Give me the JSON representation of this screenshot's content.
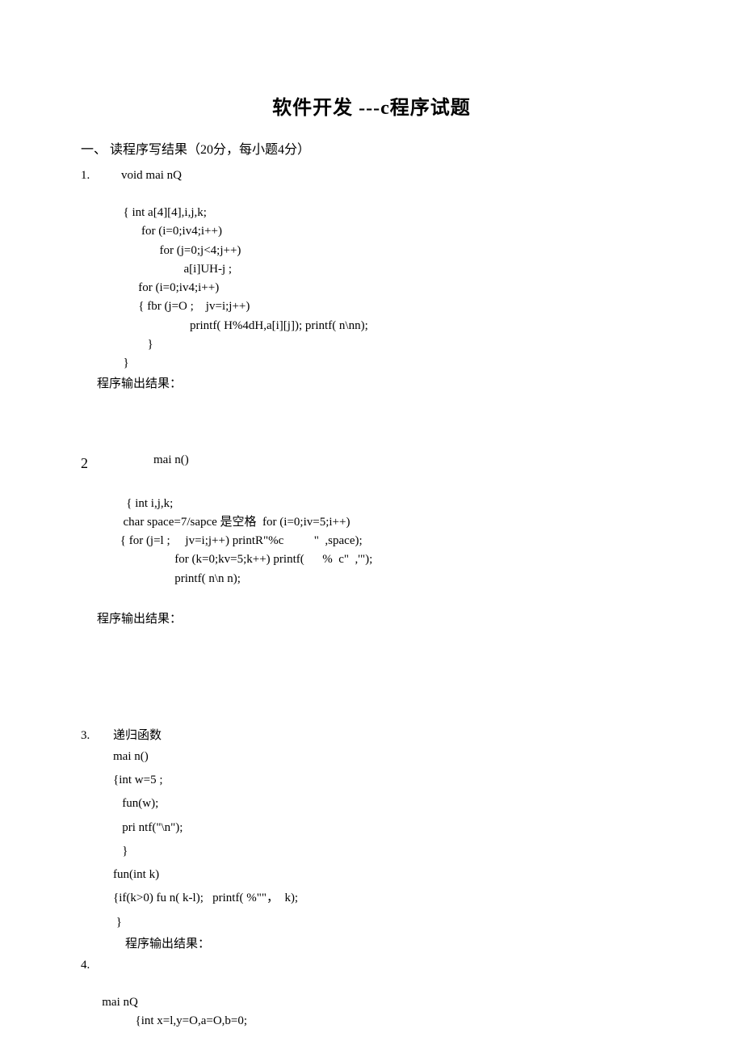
{
  "title": "软件开发 ---c程序试题",
  "section1": {
    "heading": "一、    读程序写结果（20分，每小题4分）",
    "q1": {
      "num": "1.",
      "l1": "void mai nQ",
      "l2": "{ int a[4][4],i,j,k;",
      "l3": "for (i=0;iv4;i++)",
      "l4": "for (j=0;j<4;j++)",
      "l5": "a[i]UH-j ;",
      "l6": "for (i=0;iv4;i++)",
      "l7": "{ fbr (j=O ;    jv=i;j++)",
      "l8": "printf( H%4dH,a[i][j]); printf( n\\nn);",
      "l9": "}",
      "l10": "}",
      "result": "程序输出结果："
    },
    "q2": {
      "num": "2",
      "l1": "mai n()",
      "l2": "{ int i,j,k;",
      "l3": "char space=7/sapce 是空格  for (i=0;iv=5;i++)",
      "l4": "{ for (j=l ;     jv=i;j++) printR\"%c          \"  ,space);",
      "l5": "for (k=0;kv=5;k++) printf(      %  c\"  ,'\");",
      "l6": "printf( n\\n n);",
      "result": "程序输出结果："
    },
    "q3": {
      "num": "3.",
      "label": "递归函数",
      "l1": "mai n()",
      "l2": "{int w=5 ;",
      "l3": "fun(w);",
      "l4": "pri ntf(\"\\n\");",
      "l5": "}",
      "l6": "fun(int k)",
      "l7": "{if(k>0) fu n( k-l);   printf( %\"\"，  k);",
      "l8": "}",
      "result": "程序输出结果："
    },
    "q4": {
      "num": "4.",
      "l1": "mai nQ",
      "l2": "{int x=l,y=O,a=O,b=0;"
    }
  }
}
